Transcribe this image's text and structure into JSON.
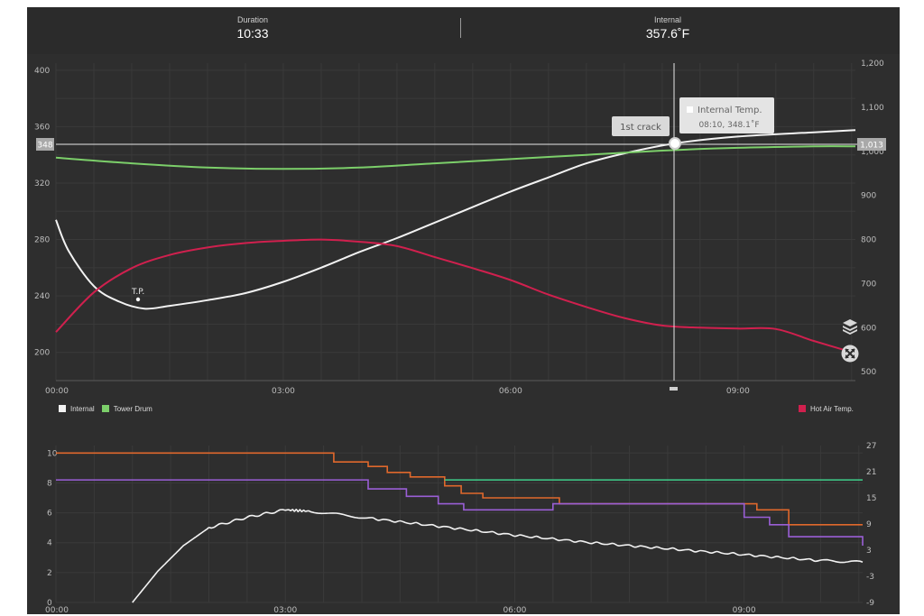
{
  "header": {
    "duration_label": "Duration",
    "duration_value": "10:33",
    "internal_label": "Internal",
    "internal_value": "357.6˚F"
  },
  "main_chart": {
    "y_left_ticks": [
      "400",
      "360",
      "320",
      "280",
      "240",
      "200"
    ],
    "y_right_ticks": [
      "1,200",
      "1,100",
      "1,000",
      "900",
      "800",
      "700",
      "600",
      "500"
    ],
    "x_ticks": [
      "00:00",
      "03:00",
      "06:00",
      "09:00"
    ],
    "crosshair_y_label": "348",
    "crosshair_right_label": "1,013",
    "tp_label": "T.P.",
    "crack_label": "1st crack",
    "tooltip_title": "Internal Temp.",
    "tooltip_value": "08:10, 348.1˚F"
  },
  "legend": {
    "internal": "Internal",
    "tower_drum": "Tower Drum",
    "hot_air": "Hot Air Temp."
  },
  "lower_chart": {
    "y_left_ticks": [
      "10",
      "8",
      "6",
      "4",
      "2",
      "0"
    ],
    "y_right_ticks": [
      "27",
      "21",
      "15",
      "9",
      "3",
      "-3",
      "-9"
    ],
    "x_ticks": [
      "00:00",
      "03:00",
      "06:00",
      "09:00"
    ]
  },
  "colors": {
    "background": "#2e2e2e",
    "internal": "#f2f2f2",
    "tower_drum": "#7ccf6a",
    "hot_air": "#d0204e",
    "orange": "#e0682c",
    "purple": "#9a5fd6",
    "teal": "#3fcf8a"
  },
  "chart_data": [
    {
      "type": "line",
      "x_unit": "mm:ss",
      "xlim": [
        "00:00",
        "10:33"
      ],
      "ylim_left": [
        180,
        405
      ],
      "ylim_right": [
        480,
        1200
      ],
      "series": [
        {
          "name": "Internal",
          "axis": "left",
          "x": [
            "00:00",
            "00:10",
            "00:30",
            "00:50",
            "01:10",
            "01:30",
            "02:00",
            "02:30",
            "03:00",
            "03:30",
            "04:00",
            "04:30",
            "05:00",
            "05:30",
            "06:00",
            "06:30",
            "07:00",
            "07:30",
            "08:10",
            "09:00",
            "10:00",
            "10:33"
          ],
          "y": [
            294,
            272,
            247,
            236,
            231,
            233,
            237,
            242,
            250,
            260,
            271,
            281,
            292,
            303,
            314,
            324,
            334,
            341,
            348.1,
            353,
            356,
            357.6
          ]
        },
        {
          "name": "Tower Drum",
          "axis": "left",
          "x": [
            "00:00",
            "01:00",
            "02:00",
            "03:00",
            "04:00",
            "05:00",
            "06:00",
            "07:00",
            "08:00",
            "09:00",
            "10:00",
            "10:33"
          ],
          "y": [
            338,
            334,
            331,
            330,
            331,
            334,
            337,
            340,
            343,
            345,
            346,
            346
          ]
        },
        {
          "name": "Hot Air Temp.",
          "axis": "right",
          "x": [
            "00:00",
            "00:30",
            "01:00",
            "01:30",
            "02:00",
            "02:30",
            "03:00",
            "03:30",
            "04:00",
            "04:30",
            "05:00",
            "05:30",
            "06:00",
            "06:30",
            "07:00",
            "07:30",
            "08:00",
            "08:30",
            "09:00",
            "09:30",
            "10:00",
            "10:33"
          ],
          "y": [
            590,
            680,
            735,
            765,
            782,
            792,
            797,
            800,
            795,
            785,
            760,
            735,
            708,
            675,
            647,
            622,
            605,
            600,
            598,
            597,
            570,
            542
          ]
        }
      ],
      "markers": [
        {
          "label": "T.P.",
          "x": "01:05",
          "y": 231
        },
        {
          "label": "1st crack",
          "x": "08:10",
          "y": 348.1
        }
      ],
      "crosshair": {
        "x": "08:10",
        "y_left": 348,
        "y_right": 1013
      }
    },
    {
      "type": "line",
      "x_unit": "mm:ss",
      "xlim": [
        "00:00",
        "10:33"
      ],
      "ylim_left": [
        0,
        10.5
      ],
      "ylim_right": [
        -9,
        27
      ],
      "series": [
        {
          "color": "orange",
          "axis": "left",
          "step": true,
          "x": [
            "00:00",
            "03:38",
            "04:05",
            "04:20",
            "04:38",
            "05:05",
            "05:18",
            "05:35",
            "06:35",
            "09:10",
            "09:35",
            "10:33"
          ],
          "y": [
            10,
            9.4,
            9.1,
            8.7,
            8.4,
            7.8,
            7.3,
            7.0,
            6.6,
            6.2,
            5.2,
            5.2
          ]
        },
        {
          "color": "purple",
          "axis": "left",
          "step": true,
          "x": [
            "00:00",
            "04:05",
            "04:35",
            "05:00",
            "05:20",
            "06:30",
            "09:00",
            "09:20",
            "09:35",
            "10:33"
          ],
          "y": [
            8.2,
            7.6,
            7.1,
            6.6,
            6.2,
            6.6,
            5.7,
            5.2,
            4.4,
            3.8
          ]
        },
        {
          "color": "teal",
          "axis": "left",
          "x": [
            "05:05",
            "10:33"
          ],
          "y": [
            8.2,
            8.2
          ]
        },
        {
          "color": "white",
          "axis": "left",
          "x": [
            "01:00",
            "01:20",
            "01:40",
            "02:00",
            "02:30",
            "03:00",
            "03:20",
            "04:00",
            "05:00",
            "06:00",
            "07:00",
            "08:00",
            "09:00",
            "10:00",
            "10:33"
          ],
          "y": [
            0,
            2.1,
            3.8,
            5.0,
            5.7,
            6.2,
            6.1,
            5.7,
            5.1,
            4.5,
            4.0,
            3.6,
            3.2,
            2.8,
            2.7
          ]
        }
      ]
    }
  ]
}
